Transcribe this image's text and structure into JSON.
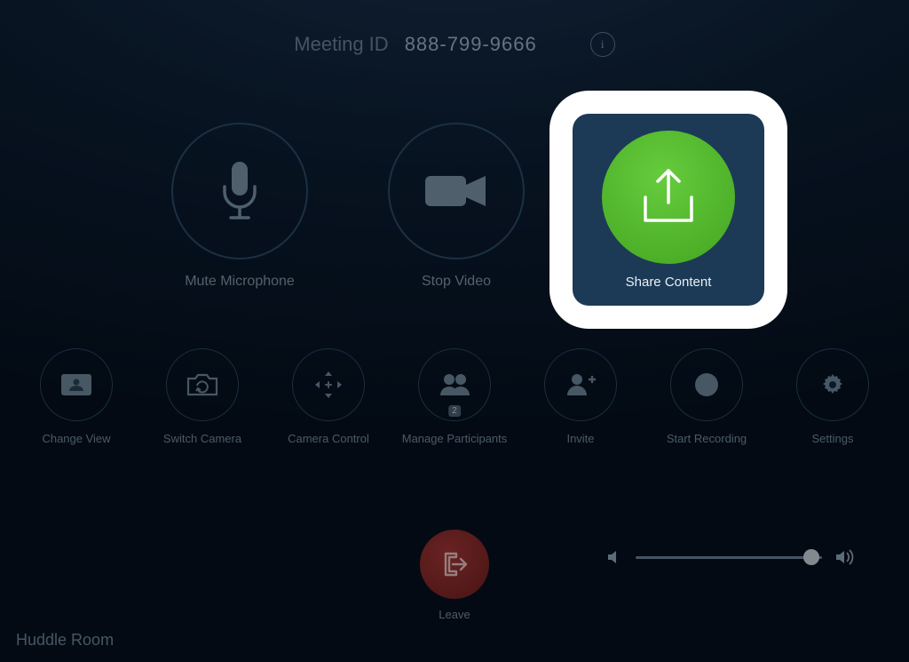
{
  "header": {
    "meeting_id_label": "Meeting ID",
    "meeting_id_value": "888-799-9666"
  },
  "primary": {
    "mute": "Mute Microphone",
    "video": "Stop Video",
    "share": "Share Content"
  },
  "secondary": {
    "change_view": "Change View",
    "switch_camera": "Switch Camera",
    "camera_control": "Camera Control",
    "participants": "Manage Participants",
    "participants_count": "2",
    "invite": "Invite",
    "record": "Start Recording",
    "settings": "Settings"
  },
  "leave": "Leave",
  "room_name": "Huddle Room"
}
